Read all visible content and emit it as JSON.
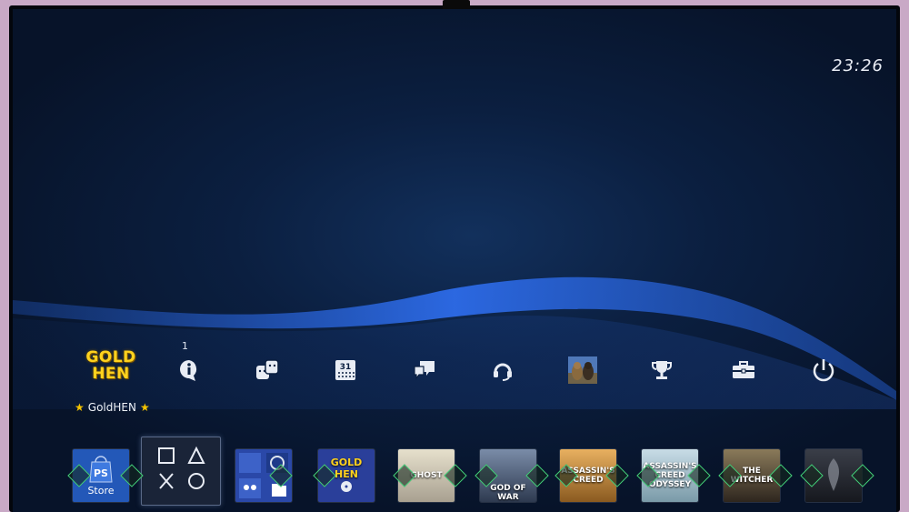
{
  "clock": "23:26",
  "notification_count": "1",
  "goldhen": {
    "logo_line1": "GOLD",
    "logo_line2": "HEN",
    "label": "GoldHEN"
  },
  "function_icons": [
    "goldhen-logo-icon",
    "info-notification-icon",
    "friends-icon",
    "calendar-icon",
    "messages-icon",
    "headset-party-icon",
    "profile-avatar-icon",
    "trophy-icon",
    "settings-toolbox-icon",
    "power-icon"
  ],
  "calendar_day": "31",
  "content_tiles": [
    {
      "name": "store",
      "label": "Store",
      "color": "#1b4fa0"
    },
    {
      "name": "library",
      "label": "",
      "color": "#1a2438"
    },
    {
      "name": "tv-video-folder",
      "label": "",
      "color": "#2a48a8"
    },
    {
      "name": "goldhen-app",
      "label": "",
      "overlay": "GOLD HEN",
      "color": "#2a3f9a"
    },
    {
      "name": "ghost-of-tsushima",
      "label": "",
      "overlay": "GHOST",
      "color": "#c8c0a8"
    },
    {
      "name": "god-of-war",
      "label": "",
      "overlay": "GOD OF WAR",
      "color": "#4c5e7c"
    },
    {
      "name": "assassins-creed-origins",
      "label": "",
      "overlay": "ASSASSIN'S CREED",
      "color": "#b88840"
    },
    {
      "name": "assassins-creed-odyssey",
      "label": "",
      "overlay": "ASSASSIN'S CREED ODYSSEY",
      "color": "#9ab0bc"
    },
    {
      "name": "the-witcher-3",
      "label": "",
      "overlay": "THE WITCHER",
      "color": "#5a4a3a"
    },
    {
      "name": "dark-game",
      "label": "",
      "color": "#2a2e36"
    }
  ],
  "colors": {
    "accent": "#2a6ae0",
    "success_diamond": "#44d07a"
  }
}
